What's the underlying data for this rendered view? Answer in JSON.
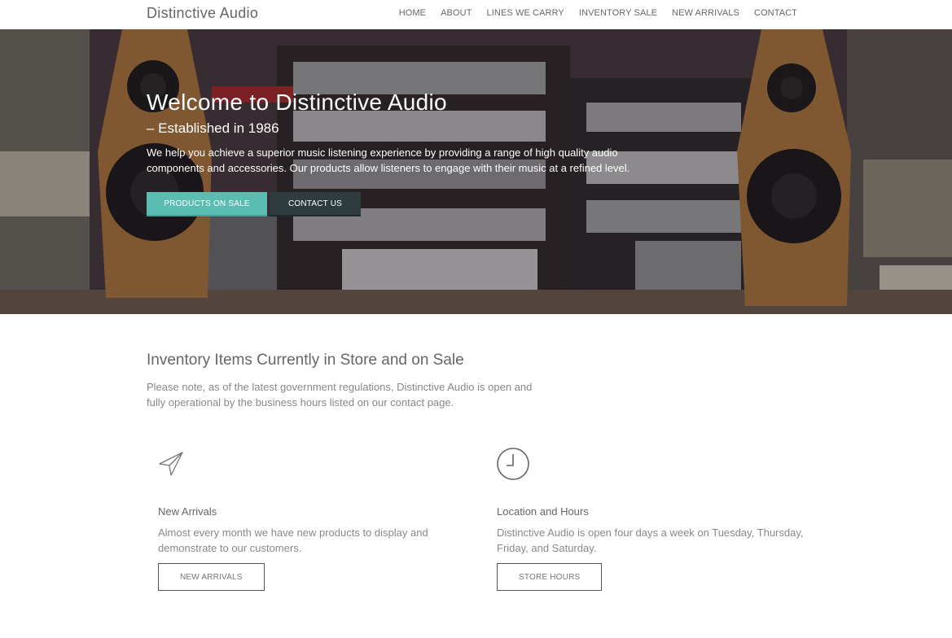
{
  "header": {
    "logo": "Distinctive Audio",
    "nav": [
      "HOME",
      "ABOUT",
      "LINES WE CARRY",
      "INVENTORY SALE",
      "NEW ARRIVALS",
      "CONTACT"
    ]
  },
  "hero": {
    "title": "Welcome to Distinctive Audio",
    "subtitle": "– Established in 1986",
    "text": "We help you achieve a superior music listening experience by providing a range of high quality audio components and accessories. Our products allow listeners to engage with their music at a refined level.",
    "primary_button": "PRODUCTS ON SALE",
    "secondary_button": "CONTACT US"
  },
  "inventory": {
    "title": "Inventory Items Currently in Store and on Sale",
    "note": "Please note, as of the latest government regulations, Distinctive Audio is open and fully operational by the business hours listed on our contact page."
  },
  "cards": [
    {
      "icon": "paper-plane-icon",
      "title": "New Arrivals",
      "text": "Almost every month we have new products to display and demonstrate to our customers.",
      "button": "NEW ARRIVALS"
    },
    {
      "icon": "clock-icon",
      "title": "Location and Hours",
      "text": "Distinctive Audio is open four days a week on Tuesday, Thursday, Friday, and Saturday.",
      "button": "STORE HOURS"
    }
  ],
  "colors": {
    "accent": "#5bbcb1",
    "dark_button": "#2f3c3f"
  }
}
